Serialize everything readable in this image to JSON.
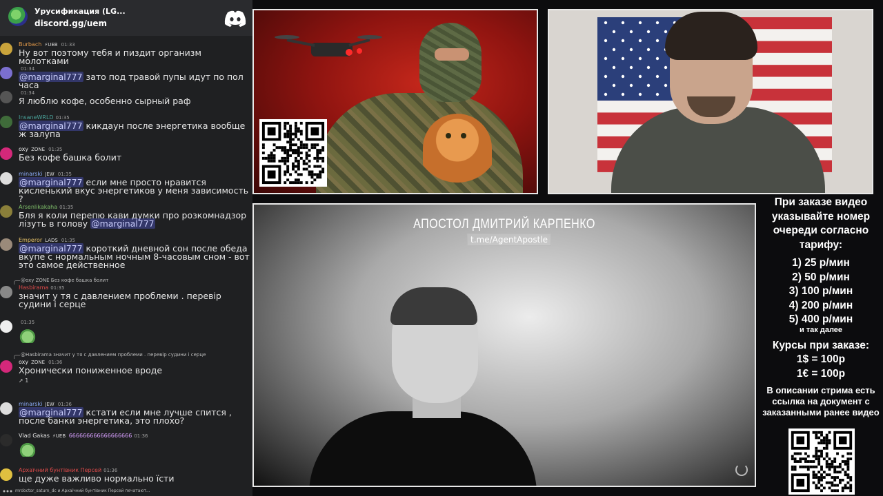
{
  "chat": {
    "server_name": "Урусификация (LG...",
    "server_invite": "discord.gg/uem",
    "messages": [
      {
        "user": "Burbach",
        "user_color": "#e69b4a",
        "badge": "⚡UEB",
        "time": "01:33",
        "text_before": "",
        "mention": "",
        "text_after": "Ну вот поэтому тебя и пиздит организм молотками",
        "avatar_color": "#c9a33b"
      },
      {
        "user": "",
        "user_color": "#bb88ff",
        "badge": "",
        "time": "01:34",
        "text_before": "",
        "mention": "@marginal777",
        "text_after": " зато под травой пупы идут по пол часа",
        "avatar_color": "#7b6fcf"
      },
      {
        "user": "",
        "user_color": "#777",
        "badge": "",
        "time": "01:34",
        "text_before": "",
        "mention": "",
        "text_after": "Я люблю кофе, особенно сырный раф",
        "avatar_color": "#555"
      },
      {
        "user": "InsaneWRLD",
        "user_color": "#4aa39a",
        "badge": "",
        "time": "01:35",
        "text_before": "",
        "mention": "@marginal777",
        "text_after": " кикдаун после энергетика вообще ж залупа",
        "avatar_color": "#3f6b3a"
      },
      {
        "user": "oxy",
        "user_color": "#f0f0f0",
        "badge": "ZONE",
        "time": "01:35",
        "text_before": "",
        "mention": "",
        "text_after": "Без кофе башка болит",
        "avatar_color": "#d4287a"
      },
      {
        "user": "minarski",
        "user_color": "#8fb0ff",
        "badge": "JEW",
        "time": "01:35",
        "text_before": "",
        "mention": "@marginal777",
        "text_after": " если мне просто нравится кисленький вкус энергетиков у меня зависимость ?",
        "avatar_color": "#ddd"
      },
      {
        "user": "Arsenlikakaha",
        "user_color": "#7fbf6a",
        "badge": "",
        "time": "01:35",
        "text_before": "Бля я коли перепю кави думки про розкомнадзор лізуть в голову ",
        "mention": "@marginal777",
        "text_after": "",
        "avatar_color": "#8a7f3a"
      },
      {
        "user": "Emperor",
        "user_color": "#e6c26a",
        "badge": "LADS",
        "time": "01:35",
        "text_before": "",
        "mention": "@marginal777",
        "text_after": " короткий дневной сон после обеда вкупе с нормальным ночным 8-часовым сном - вот это самое действенное",
        "avatar_color": "#9a8a7a"
      },
      {
        "user": "Hasbirama",
        "user_color": "#e04a4a",
        "badge": "",
        "time": "01:35",
        "reply": "@oxy ZONE Без кофе башка болит",
        "text_before": "",
        "mention": "",
        "text_after": "значит у тя с давлением проблеми . перевір судини і серце",
        "avatar_color": "#888"
      },
      {
        "user": "",
        "user_color": "#555",
        "badge": "",
        "time": "01:35",
        "text_before": "",
        "mention": "",
        "text_after": "",
        "avatar_color": "#eee"
      },
      {
        "user": "oxy",
        "user_color": "#f0f0f0",
        "badge": "ZONE",
        "time": "01:36",
        "reply": "@Hasbirama значит у тя с давлением проблеми . перевір судини і серце",
        "text_before": "",
        "mention": "",
        "text_after": "Хронически пониженное вроде",
        "avatar_color": "#d4287a",
        "reaction": "1"
      },
      {
        "user": "minarski",
        "user_color": "#8fb0ff",
        "badge": "JEW",
        "time": "01:36",
        "text_before": "",
        "mention": "@marginal777",
        "text_after": " кстати если мне лучше спится , после банки энергетика, это плохо?",
        "avatar_color": "#ddd"
      },
      {
        "user": "Vlad Gakas",
        "user_color": "#e6e6e6",
        "badge": "⚡UEB",
        "time": "01:36",
        "extra": "666666666666666666",
        "text_before": "",
        "mention": "",
        "text_after": "",
        "avatar_color": "#2b2b2b"
      },
      {
        "user": "Архаїчний бунтівник Персей",
        "user_color": "#e04a4a",
        "badge": "",
        "time": "01:36",
        "text_before": "",
        "mention": "",
        "text_after": "ще дуже важливо нормально їсти",
        "avatar_color": "#e0c040"
      }
    ],
    "typing": "mrdoctor_saturn_dc и Архаїчний бунтівник Персей печатают..."
  },
  "main_panel": {
    "title": "АПОСТОЛ ДМИТРИЙ КАРПЕНКО",
    "link": "t.me/AgentApostle"
  },
  "info": {
    "heading": "При заказе видео указывайте номер очереди согласно тарифу:",
    "tariffs": [
      "1) 25 р/мин",
      "2) 50 р/мин",
      "3) 100 р/мин",
      "4) 200 р/мин",
      "5) 400 р/мин"
    ],
    "tariffs_more": "и так далее",
    "rates_heading": "Курсы при заказе:",
    "rates": [
      "1$ = 100р",
      "1€ = 100р"
    ],
    "note": "В описании стрима есть ссылка на документ с заказанными ранее видео"
  },
  "icons": {
    "server": "server-icon",
    "discord": "discord-logo-icon",
    "qr": "qr-code-icon",
    "loader": "loading-spinner-icon"
  },
  "colors": {
    "mention_bg": "#5865f2",
    "chat_bg": "#1f2022",
    "accent_red": "#c4271b"
  }
}
